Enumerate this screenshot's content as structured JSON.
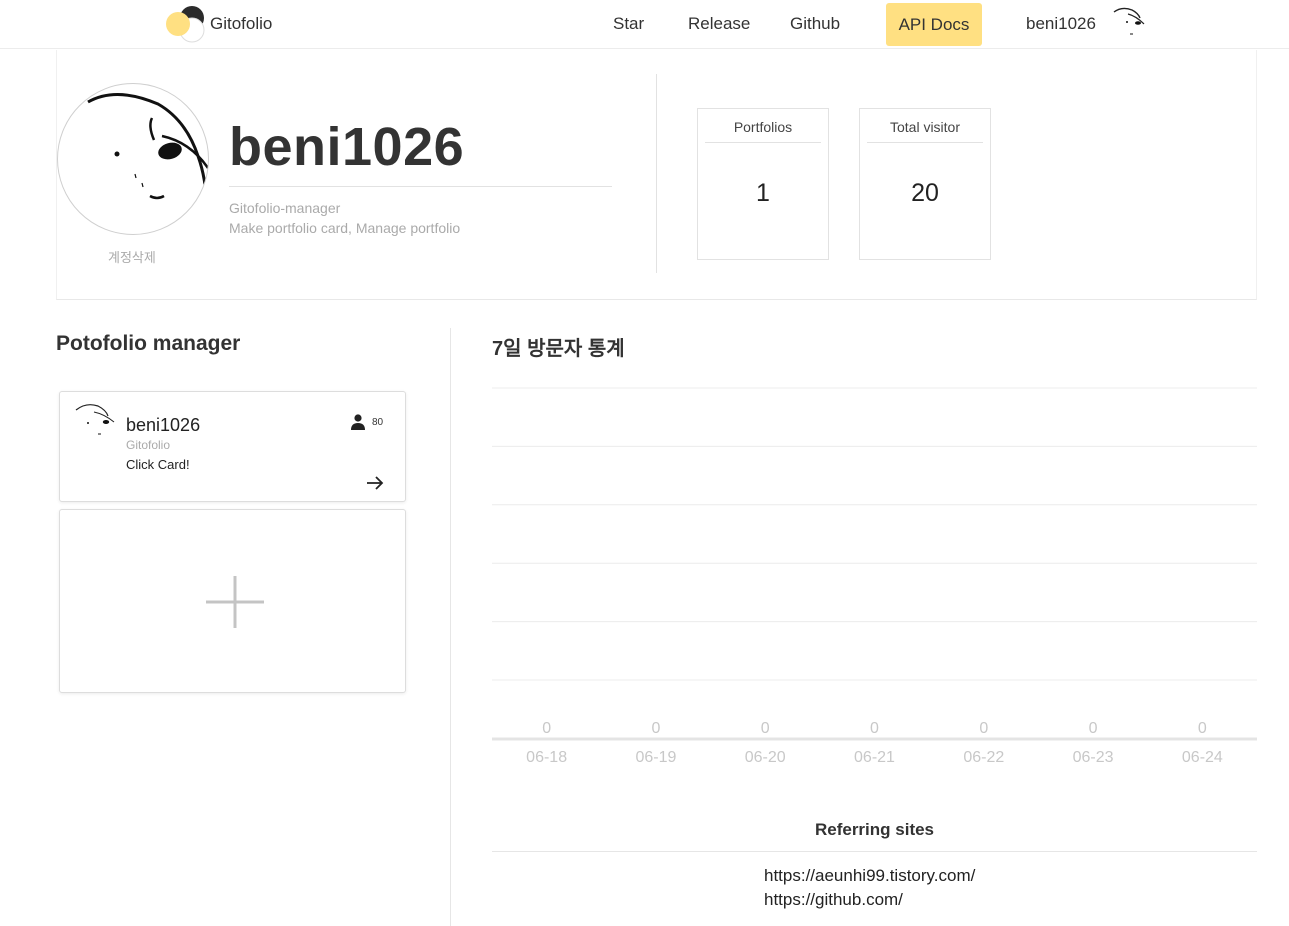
{
  "nav": {
    "brand": "Gitofolio",
    "links": [
      "Star",
      "Release",
      "Github"
    ],
    "api_docs": "API Docs",
    "username": "beni1026"
  },
  "profile": {
    "username": "beni1026",
    "bio_line1": "Gitofolio-manager",
    "bio_line2": "Make portfolio card, Manage portfolio",
    "delete_account": "계정삭제",
    "stats": [
      {
        "label": "Portfolios",
        "value": "1"
      },
      {
        "label": "Total visitor",
        "value": "20"
      }
    ]
  },
  "manager": {
    "title": "Potofolio manager",
    "card": {
      "name": "beni1026",
      "subtitle": "Gitofolio",
      "description": "Click Card!",
      "visits": "80"
    }
  },
  "stats_panel": {
    "title": "7일 방문자 통계"
  },
  "chart_data": {
    "type": "bar",
    "categories": [
      "06-18",
      "06-19",
      "06-20",
      "06-21",
      "06-22",
      "06-23",
      "06-24"
    ],
    "values": [
      0,
      0,
      0,
      0,
      0,
      0,
      0
    ],
    "grid": true,
    "gridlines": 6,
    "label_color": "#c8c8c8",
    "grid_color": "#ececec"
  },
  "referring": {
    "title": "Referring sites",
    "sites": [
      "https://aeunhi99.tistory.com/",
      "https://github.com/"
    ]
  },
  "colors": {
    "accent": "#ffe082",
    "muted_text": "#aaaaaa",
    "border": "#e2e2e2"
  }
}
